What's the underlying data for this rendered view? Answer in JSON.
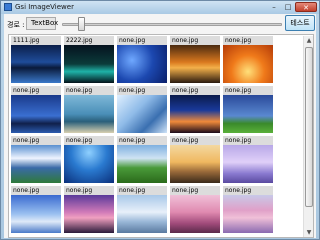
{
  "window": {
    "title": "Gsi ImageViewer",
    "close_glyph": "✕",
    "min_glyph": "–",
    "max_glyph": "□"
  },
  "toolbar": {
    "path_label": "경로 :",
    "path_value": "TextBox",
    "test_button": "테스트"
  },
  "gallery": {
    "tiles": [
      {
        "name": "1111.jpg",
        "scene": "night-city-coast"
      },
      {
        "name": "2222.jpg",
        "scene": "night-city-lights"
      },
      {
        "name": "none.jpg",
        "scene": "blue-pebbles"
      },
      {
        "name": "none.jpg",
        "scene": "golden-gate-sunset"
      },
      {
        "name": "none.jpg",
        "scene": "orange-sunset"
      },
      {
        "name": "none.jpg",
        "scene": "blue-skyline"
      },
      {
        "name": "none.jpg",
        "scene": "palm-beach"
      },
      {
        "name": "none.jpg",
        "scene": "ice-waves"
      },
      {
        "name": "none.jpg",
        "scene": "sunset-silhouette"
      },
      {
        "name": "none.jpg",
        "scene": "green-meadow-sky"
      },
      {
        "name": "none.jpg",
        "scene": "mountain-lake"
      },
      {
        "name": "none.jpg",
        "scene": "underwater-blue"
      },
      {
        "name": "none.jpg",
        "scene": "green-hills"
      },
      {
        "name": "none.jpg",
        "scene": "lighthouse-dusk"
      },
      {
        "name": "none.jpg",
        "scene": "lavender-sky"
      },
      {
        "name": "none.jpg",
        "scene": "blue-clouds"
      },
      {
        "name": "none.jpg",
        "scene": "pink-palm-sunset"
      },
      {
        "name": "none.jpg",
        "scene": "frozen-lake"
      },
      {
        "name": "none.jpg",
        "scene": "pink-forest"
      },
      {
        "name": "none.jpg",
        "scene": "pink-flowers"
      }
    ]
  },
  "scrollbar": {
    "up_glyph": "▲",
    "down_glyph": "▼"
  },
  "colors": {
    "window_frame": "#bcd6ea",
    "accent": "#3c7fb1",
    "tile_label_bg": "#dcdcdc"
  }
}
